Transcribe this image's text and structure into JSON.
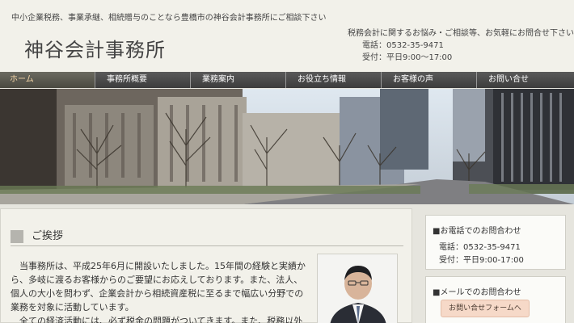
{
  "header": {
    "tagline": "中小企業税務、事業承継、相続贈与のことなら豊橋市の神谷会計事務所にご相談下さい",
    "site_title": "神谷会計事務所",
    "contact_intro": "税務会計に関するお悩み・ご相談等、お気軽にお問合せ下さい",
    "phone": "電話：0532-35-9471",
    "hours": "受付：平日9:00～17:00"
  },
  "nav": {
    "items": [
      {
        "label": "ホーム"
      },
      {
        "label": "事務所概要"
      },
      {
        "label": "業務案内"
      },
      {
        "label": "お役立ち情報"
      },
      {
        "label": "お客様の声"
      },
      {
        "label": "お問い合せ"
      }
    ]
  },
  "greeting": {
    "title": "ご挨拶",
    "paragraph1": "当事務所は、平成25年6月に開設いたしました。15年間の経験と実績から、多岐に渡るお客様からのご要望にお応えしております。また、法人、個人の大小を問わず、企業会計から相続資産税に至るまで幅広い分野での業務を対象に活動しています。",
    "paragraph2": "全ての経済活動には、必ず税金の問題がついてきます。また、税務以外"
  },
  "side": {
    "phone_box": {
      "title": "■お電話でのお問合わせ",
      "phone": "電話：0532-35-9471",
      "hours": "受付：平日9:00-17:00"
    },
    "mail_box": {
      "title": "■メールでのお問合わせ",
      "button": "お問い合せフォームへ"
    }
  },
  "colors": {
    "nav_bg": "#4a4a4a",
    "nav_active_text": "#f5d6a8",
    "form_button": "#f6d9c8"
  }
}
